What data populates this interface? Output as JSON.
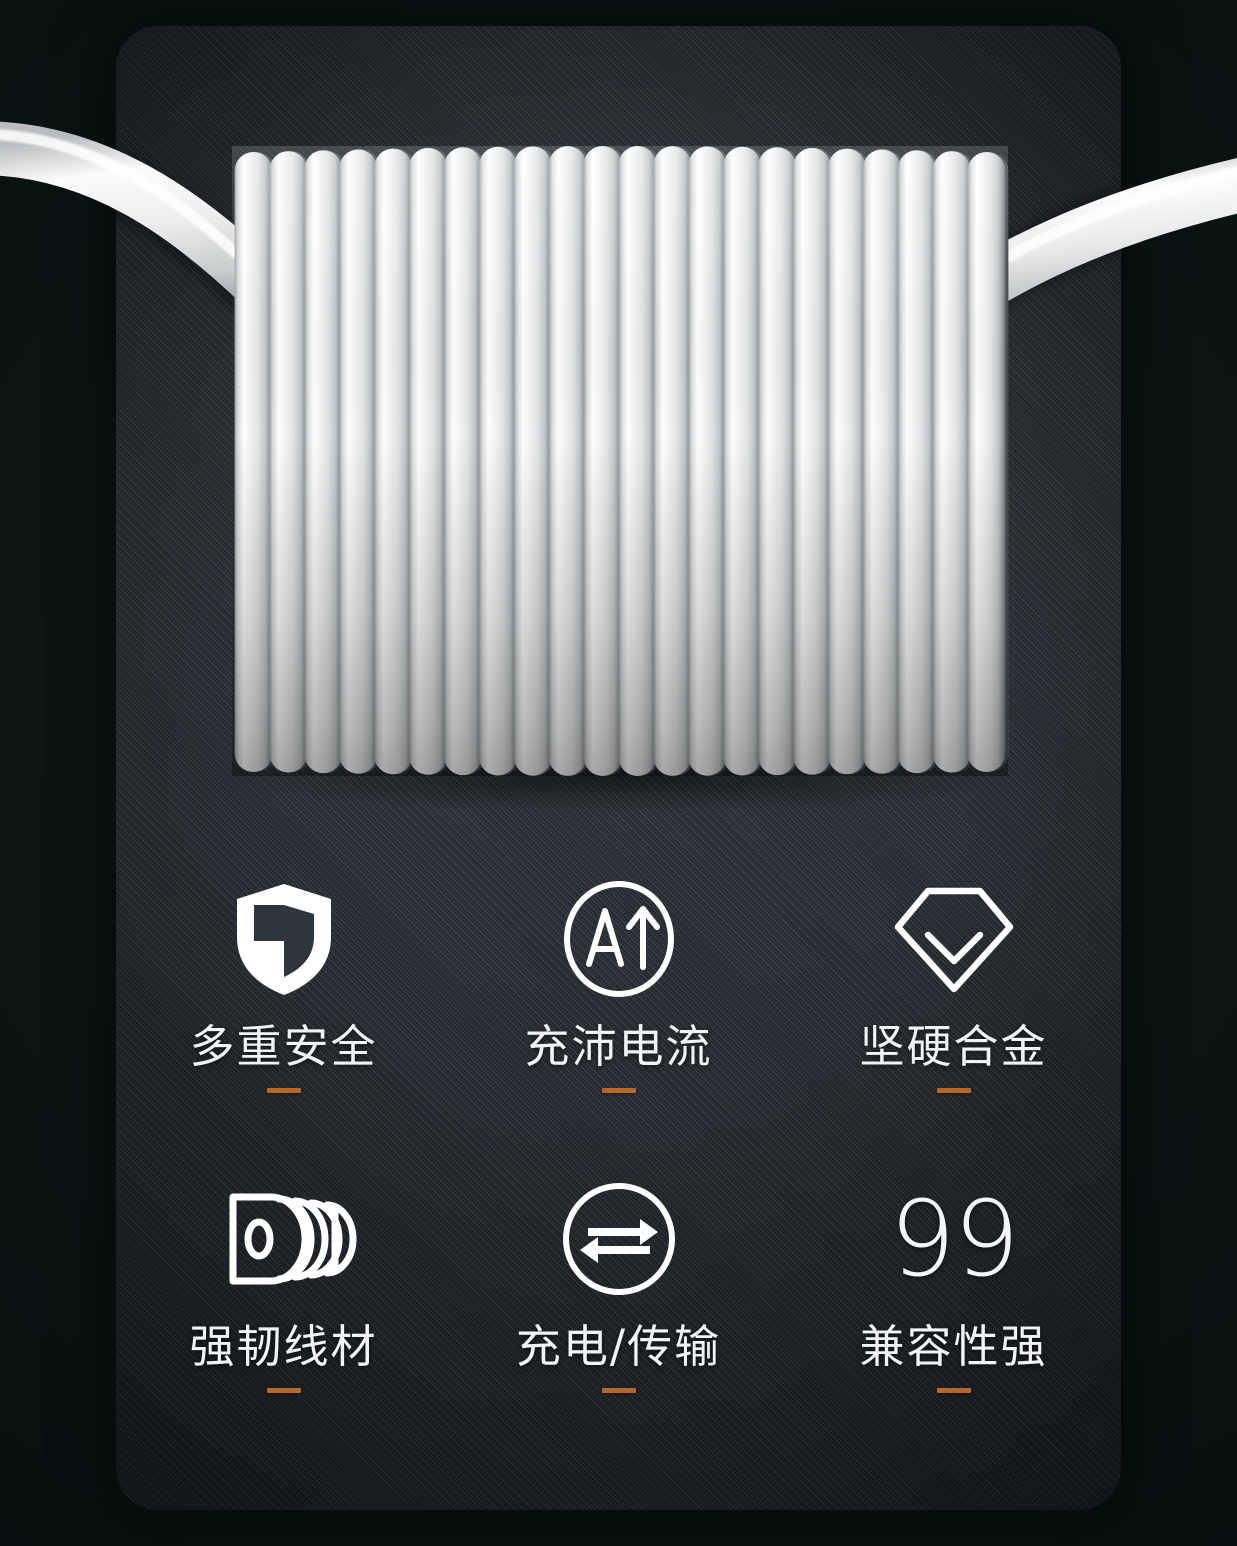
{
  "page": {
    "kind": "product-marketing-image",
    "background_color": "#0a1513",
    "card_color": "#333941",
    "accent_color": "#b4682e",
    "text_color": "#f2f3f4"
  },
  "hero": {
    "subject": "coiled-white-charging-cable",
    "cable_color": "#f2f3f3",
    "coil_loop_count": 22
  },
  "features": {
    "rows": [
      [
        {
          "icon": "shield-icon",
          "label": "多重安全",
          "accent": "#b4682e"
        },
        {
          "icon": "ampere-up-arrow-circle-icon",
          "label": "充沛电流",
          "icon_text": "A",
          "accent": "#b4682e"
        },
        {
          "icon": "diamond-check-icon",
          "label": "坚硬合金",
          "accent": "#b4682e"
        }
      ],
      [
        {
          "icon": "cable-coil-icon",
          "label": "强韧线材",
          "accent": "#b4682e"
        },
        {
          "icon": "bidirectional-arrows-circle-icon",
          "label": "充电/传输",
          "accent": "#b4682e"
        },
        {
          "icon": "number-99-icon",
          "label": "兼容性强",
          "icon_text": "99",
          "accent": "#b4682e"
        }
      ]
    ]
  }
}
